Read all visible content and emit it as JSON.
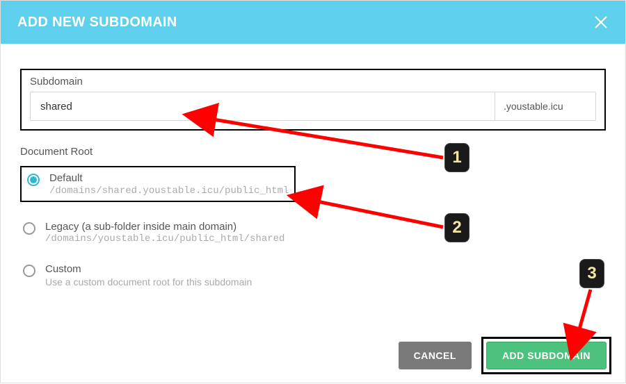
{
  "header": {
    "title": "ADD NEW SUBDOMAIN"
  },
  "subdomain": {
    "label": "Subdomain",
    "value": "shared",
    "suffix": ".youstable.icu"
  },
  "docroot": {
    "label": "Document Root",
    "options": [
      {
        "title": "Default",
        "path": "/domains/shared.youstable.icu/public_html",
        "selected": true
      },
      {
        "title": "Legacy (a sub-folder inside main domain)",
        "path": "/domains/youstable.icu/public_html/shared",
        "selected": false
      },
      {
        "title": "Custom",
        "path": "Use a custom document root for this subdomain",
        "selected": false
      }
    ]
  },
  "buttons": {
    "cancel": "CANCEL",
    "add": "ADD SUBDOMAIN"
  },
  "callouts": {
    "one": "1",
    "two": "2",
    "three": "3"
  }
}
